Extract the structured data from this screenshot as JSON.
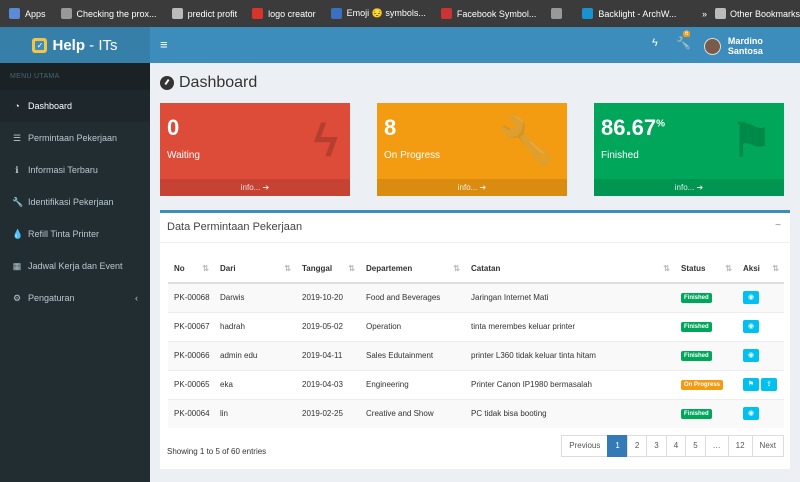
{
  "bookmarks": {
    "items": [
      {
        "icon": "apps-grid-icon",
        "label": "Apps",
        "color": "#5a8bd6"
      },
      {
        "icon": "globe-icon",
        "label": "Checking the prox...",
        "color": "#999999"
      },
      {
        "icon": "folder-icon",
        "label": "predict profit",
        "color": "#bbbbbb"
      },
      {
        "icon": "logo-creator-icon",
        "label": "logo creator",
        "color": "#d9342b"
      },
      {
        "icon": "emoji-site-icon",
        "label": "Emoji 😔 symbols...",
        "color": "#3b6fc2"
      },
      {
        "icon": "facebook-symbols-icon",
        "label": "Facebook Symbol...",
        "color": "#cc3333"
      },
      {
        "icon": "globe-icon",
        "label": "",
        "color": "#999999"
      },
      {
        "icon": "archwiki-icon",
        "label": "Backlight - ArchW...",
        "color": "#1793d1"
      }
    ],
    "overflow": "»",
    "other": "Other Bookmarks"
  },
  "header": {
    "brand": "Help",
    "brand_suffix": "- ITs",
    "hamburger": "≡",
    "bolt": "ϟ",
    "wrench": "🔧",
    "badge": "6",
    "user": "Mardino Santosa"
  },
  "sidebar": {
    "heading": "MENU UTAMA",
    "items": [
      {
        "icon": "dashboard-icon",
        "glyph": "◔",
        "label": "Dashboard"
      },
      {
        "icon": "list-icon",
        "glyph": "☰",
        "label": "Permintaan Pekerjaan"
      },
      {
        "icon": "info-icon",
        "glyph": "ℹ",
        "label": "Informasi Terbaru"
      },
      {
        "icon": "wrench-icon",
        "glyph": "🔧",
        "label": "Identifikasi Pekerjaan"
      },
      {
        "icon": "ink-drop-icon",
        "glyph": "💧",
        "label": "Refill Tinta Printer"
      },
      {
        "icon": "calendar-icon",
        "glyph": "▦",
        "label": "Jadwal Kerja dan Event"
      },
      {
        "icon": "gear-icon",
        "glyph": "⚙",
        "label": "Pengaturan",
        "chevron": "‹"
      }
    ]
  },
  "page": {
    "title": "Dashboard"
  },
  "stats": [
    {
      "value": "0",
      "sup": "",
      "label": "Waiting",
      "more": "info... ➔",
      "icon": "bolt-icon",
      "glyph": "ϟ",
      "color": "#dd4b39"
    },
    {
      "value": "8",
      "sup": "",
      "label": "On Progress",
      "more": "info... ➔",
      "icon": "wrench-icon",
      "glyph": "🔧",
      "color": "#f39c12"
    },
    {
      "value": "86.67",
      "sup": "%",
      "label": "Finished",
      "more": "info... ➔",
      "icon": "flag-checkered-icon",
      "glyph": "⚑",
      "color": "#00a65a"
    }
  ],
  "panel": {
    "title": "Data Permintaan Pekerjaan",
    "minimize": "−",
    "columns": [
      "No",
      "Dari",
      "Tanggal",
      "Departemen",
      "Catatan",
      "Status",
      "Aksi"
    ],
    "sort_glyph": "⇅",
    "rows": [
      {
        "no": "PK-00068",
        "dari": "Darwis",
        "tanggal": "2019-10-20",
        "dept": "Food and Beverages",
        "catatan": "Jaringan Internet Mati",
        "status": "Finished",
        "status_color": "#00a65a",
        "actions": [
          "view-icon"
        ]
      },
      {
        "no": "PK-00067",
        "dari": "hadrah",
        "tanggal": "2019-05-02",
        "dept": "Operation",
        "catatan": "tinta merembes keluar printer",
        "status": "Finished",
        "status_color": "#00a65a",
        "actions": [
          "view-icon"
        ]
      },
      {
        "no": "PK-00066",
        "dari": "admin edu",
        "tanggal": "2019-04-11",
        "dept": "Sales Edutainment",
        "catatan": "printer L360 tidak keluar tinta hitam",
        "status": "Finished",
        "status_color": "#00a65a",
        "actions": [
          "view-icon"
        ]
      },
      {
        "no": "PK-00065",
        "dari": "eka",
        "tanggal": "2019-04-03",
        "dept": "Engineering",
        "catatan": "Printer Canon IP1980 bermasalah",
        "status": "On Progress",
        "status_color": "#f39c12",
        "actions": [
          "flag-icon",
          "upload-icon"
        ]
      },
      {
        "no": "PK-00064",
        "dari": "lin",
        "tanggal": "2019-02-25",
        "dept": "Creative and Show",
        "catatan": "PC tidak bisa booting",
        "status": "Finished",
        "status_color": "#00a65a",
        "actions": [
          "view-icon"
        ]
      }
    ],
    "action_glyphs": {
      "view-icon": "◉",
      "flag-icon": "⚑",
      "upload-icon": "⇪"
    },
    "info": "Showing 1 to 5 of 60 entries",
    "pagination": [
      "Previous",
      "1",
      "2",
      "3",
      "4",
      "5",
      "…",
      "12",
      "Next"
    ],
    "active_page": "1"
  }
}
